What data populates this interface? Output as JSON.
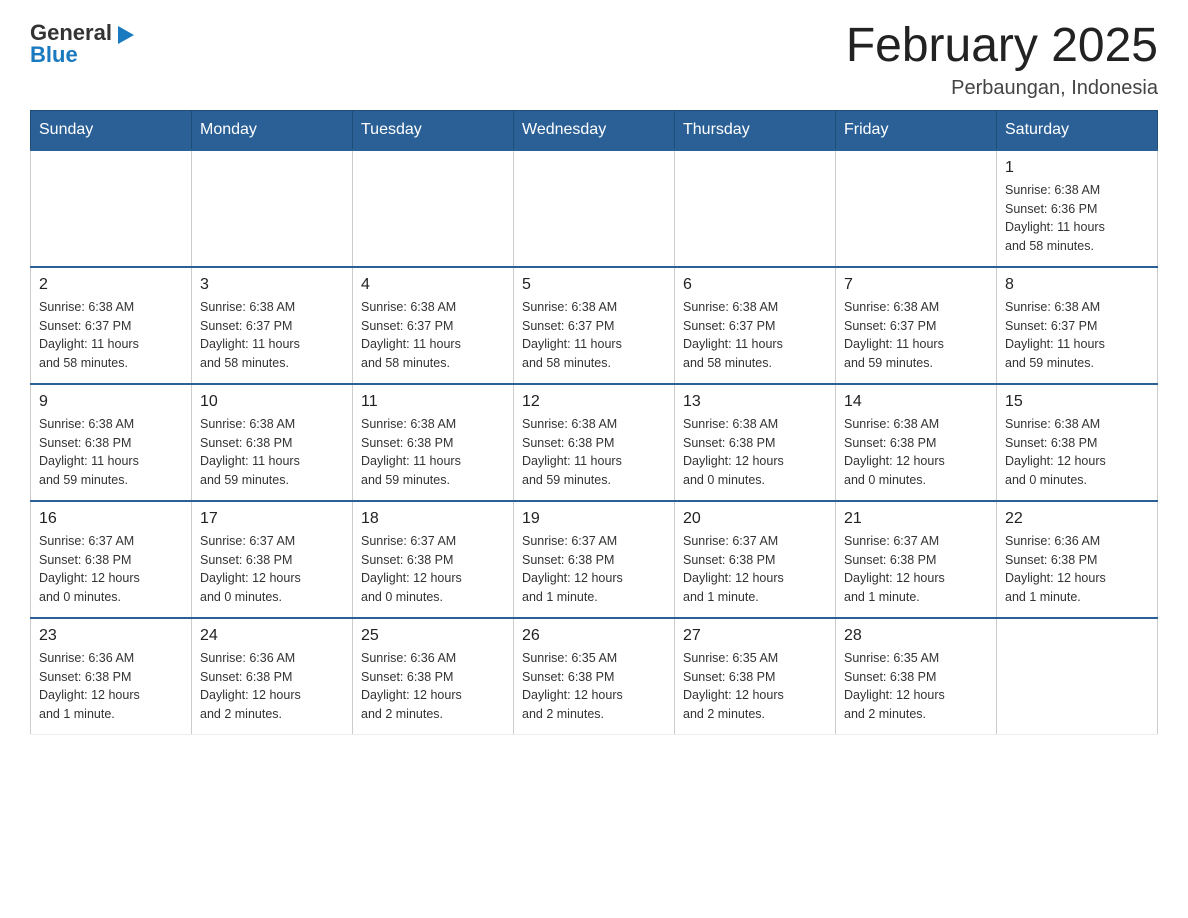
{
  "logo": {
    "general": "General",
    "blue": "Blue",
    "arrow": "▶"
  },
  "title": "February 2025",
  "location": "Perbaungan, Indonesia",
  "days_of_week": [
    "Sunday",
    "Monday",
    "Tuesday",
    "Wednesday",
    "Thursday",
    "Friday",
    "Saturday"
  ],
  "weeks": [
    [
      {
        "day": "",
        "info": ""
      },
      {
        "day": "",
        "info": ""
      },
      {
        "day": "",
        "info": ""
      },
      {
        "day": "",
        "info": ""
      },
      {
        "day": "",
        "info": ""
      },
      {
        "day": "",
        "info": ""
      },
      {
        "day": "1",
        "info": "Sunrise: 6:38 AM\nSunset: 6:36 PM\nDaylight: 11 hours\nand 58 minutes."
      }
    ],
    [
      {
        "day": "2",
        "info": "Sunrise: 6:38 AM\nSunset: 6:37 PM\nDaylight: 11 hours\nand 58 minutes."
      },
      {
        "day": "3",
        "info": "Sunrise: 6:38 AM\nSunset: 6:37 PM\nDaylight: 11 hours\nand 58 minutes."
      },
      {
        "day": "4",
        "info": "Sunrise: 6:38 AM\nSunset: 6:37 PM\nDaylight: 11 hours\nand 58 minutes."
      },
      {
        "day": "5",
        "info": "Sunrise: 6:38 AM\nSunset: 6:37 PM\nDaylight: 11 hours\nand 58 minutes."
      },
      {
        "day": "6",
        "info": "Sunrise: 6:38 AM\nSunset: 6:37 PM\nDaylight: 11 hours\nand 58 minutes."
      },
      {
        "day": "7",
        "info": "Sunrise: 6:38 AM\nSunset: 6:37 PM\nDaylight: 11 hours\nand 59 minutes."
      },
      {
        "day": "8",
        "info": "Sunrise: 6:38 AM\nSunset: 6:37 PM\nDaylight: 11 hours\nand 59 minutes."
      }
    ],
    [
      {
        "day": "9",
        "info": "Sunrise: 6:38 AM\nSunset: 6:38 PM\nDaylight: 11 hours\nand 59 minutes."
      },
      {
        "day": "10",
        "info": "Sunrise: 6:38 AM\nSunset: 6:38 PM\nDaylight: 11 hours\nand 59 minutes."
      },
      {
        "day": "11",
        "info": "Sunrise: 6:38 AM\nSunset: 6:38 PM\nDaylight: 11 hours\nand 59 minutes."
      },
      {
        "day": "12",
        "info": "Sunrise: 6:38 AM\nSunset: 6:38 PM\nDaylight: 11 hours\nand 59 minutes."
      },
      {
        "day": "13",
        "info": "Sunrise: 6:38 AM\nSunset: 6:38 PM\nDaylight: 12 hours\nand 0 minutes."
      },
      {
        "day": "14",
        "info": "Sunrise: 6:38 AM\nSunset: 6:38 PM\nDaylight: 12 hours\nand 0 minutes."
      },
      {
        "day": "15",
        "info": "Sunrise: 6:38 AM\nSunset: 6:38 PM\nDaylight: 12 hours\nand 0 minutes."
      }
    ],
    [
      {
        "day": "16",
        "info": "Sunrise: 6:37 AM\nSunset: 6:38 PM\nDaylight: 12 hours\nand 0 minutes."
      },
      {
        "day": "17",
        "info": "Sunrise: 6:37 AM\nSunset: 6:38 PM\nDaylight: 12 hours\nand 0 minutes."
      },
      {
        "day": "18",
        "info": "Sunrise: 6:37 AM\nSunset: 6:38 PM\nDaylight: 12 hours\nand 0 minutes."
      },
      {
        "day": "19",
        "info": "Sunrise: 6:37 AM\nSunset: 6:38 PM\nDaylight: 12 hours\nand 1 minute."
      },
      {
        "day": "20",
        "info": "Sunrise: 6:37 AM\nSunset: 6:38 PM\nDaylight: 12 hours\nand 1 minute."
      },
      {
        "day": "21",
        "info": "Sunrise: 6:37 AM\nSunset: 6:38 PM\nDaylight: 12 hours\nand 1 minute."
      },
      {
        "day": "22",
        "info": "Sunrise: 6:36 AM\nSunset: 6:38 PM\nDaylight: 12 hours\nand 1 minute."
      }
    ],
    [
      {
        "day": "23",
        "info": "Sunrise: 6:36 AM\nSunset: 6:38 PM\nDaylight: 12 hours\nand 1 minute."
      },
      {
        "day": "24",
        "info": "Sunrise: 6:36 AM\nSunset: 6:38 PM\nDaylight: 12 hours\nand 2 minutes."
      },
      {
        "day": "25",
        "info": "Sunrise: 6:36 AM\nSunset: 6:38 PM\nDaylight: 12 hours\nand 2 minutes."
      },
      {
        "day": "26",
        "info": "Sunrise: 6:35 AM\nSunset: 6:38 PM\nDaylight: 12 hours\nand 2 minutes."
      },
      {
        "day": "27",
        "info": "Sunrise: 6:35 AM\nSunset: 6:38 PM\nDaylight: 12 hours\nand 2 minutes."
      },
      {
        "day": "28",
        "info": "Sunrise: 6:35 AM\nSunset: 6:38 PM\nDaylight: 12 hours\nand 2 minutes."
      },
      {
        "day": "",
        "info": ""
      }
    ]
  ]
}
